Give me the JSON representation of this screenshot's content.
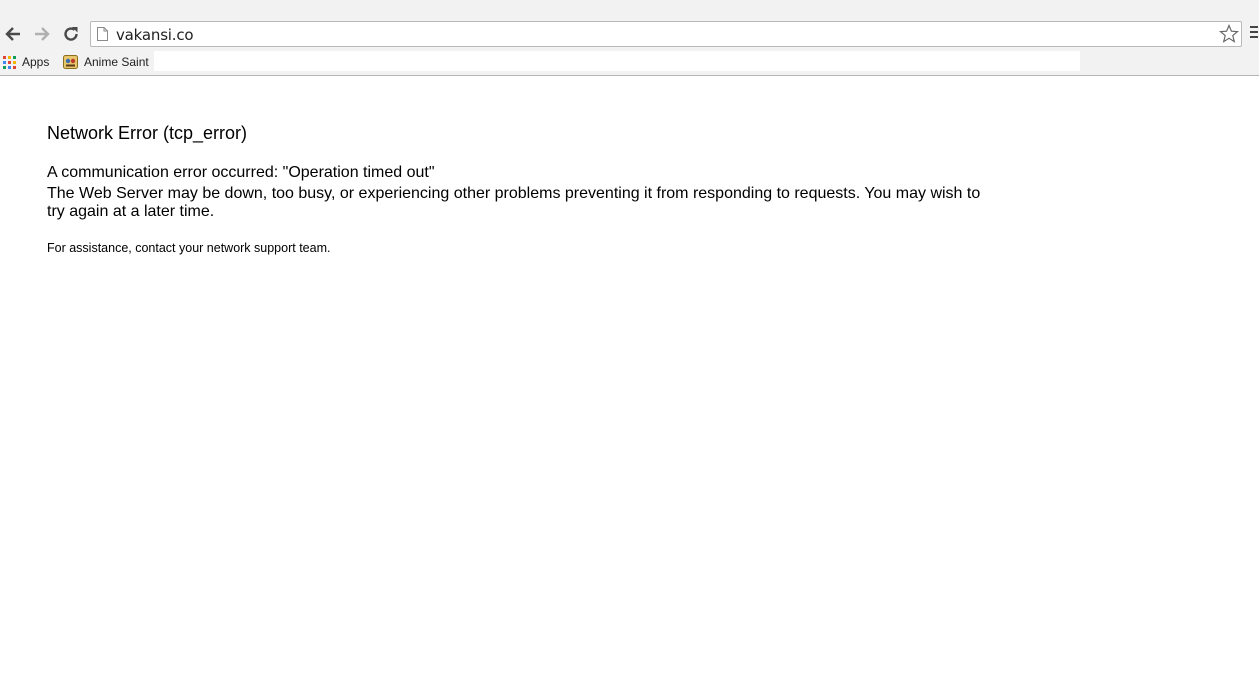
{
  "browser": {
    "url": "vakansi.co",
    "bookmarks": [
      {
        "label": "Apps",
        "icon": "apps-grid-icon"
      },
      {
        "label": "Anime Saint",
        "icon": "anime-saint-favicon"
      }
    ],
    "colors": {
      "toolbar": "#f2f2f2",
      "nav_icon": "#4a4a4a",
      "nav_icon_disabled": "#b0b0b0"
    }
  },
  "page": {
    "title": "Network Error (tcp_error)",
    "error_line": "A communication error occurred: \"Operation timed out\"",
    "description": "The Web Server may be down, too busy, or experiencing other problems preventing it from responding to requests. You may wish to try again at a later time.",
    "assistance": "For assistance, contact your network support team."
  }
}
